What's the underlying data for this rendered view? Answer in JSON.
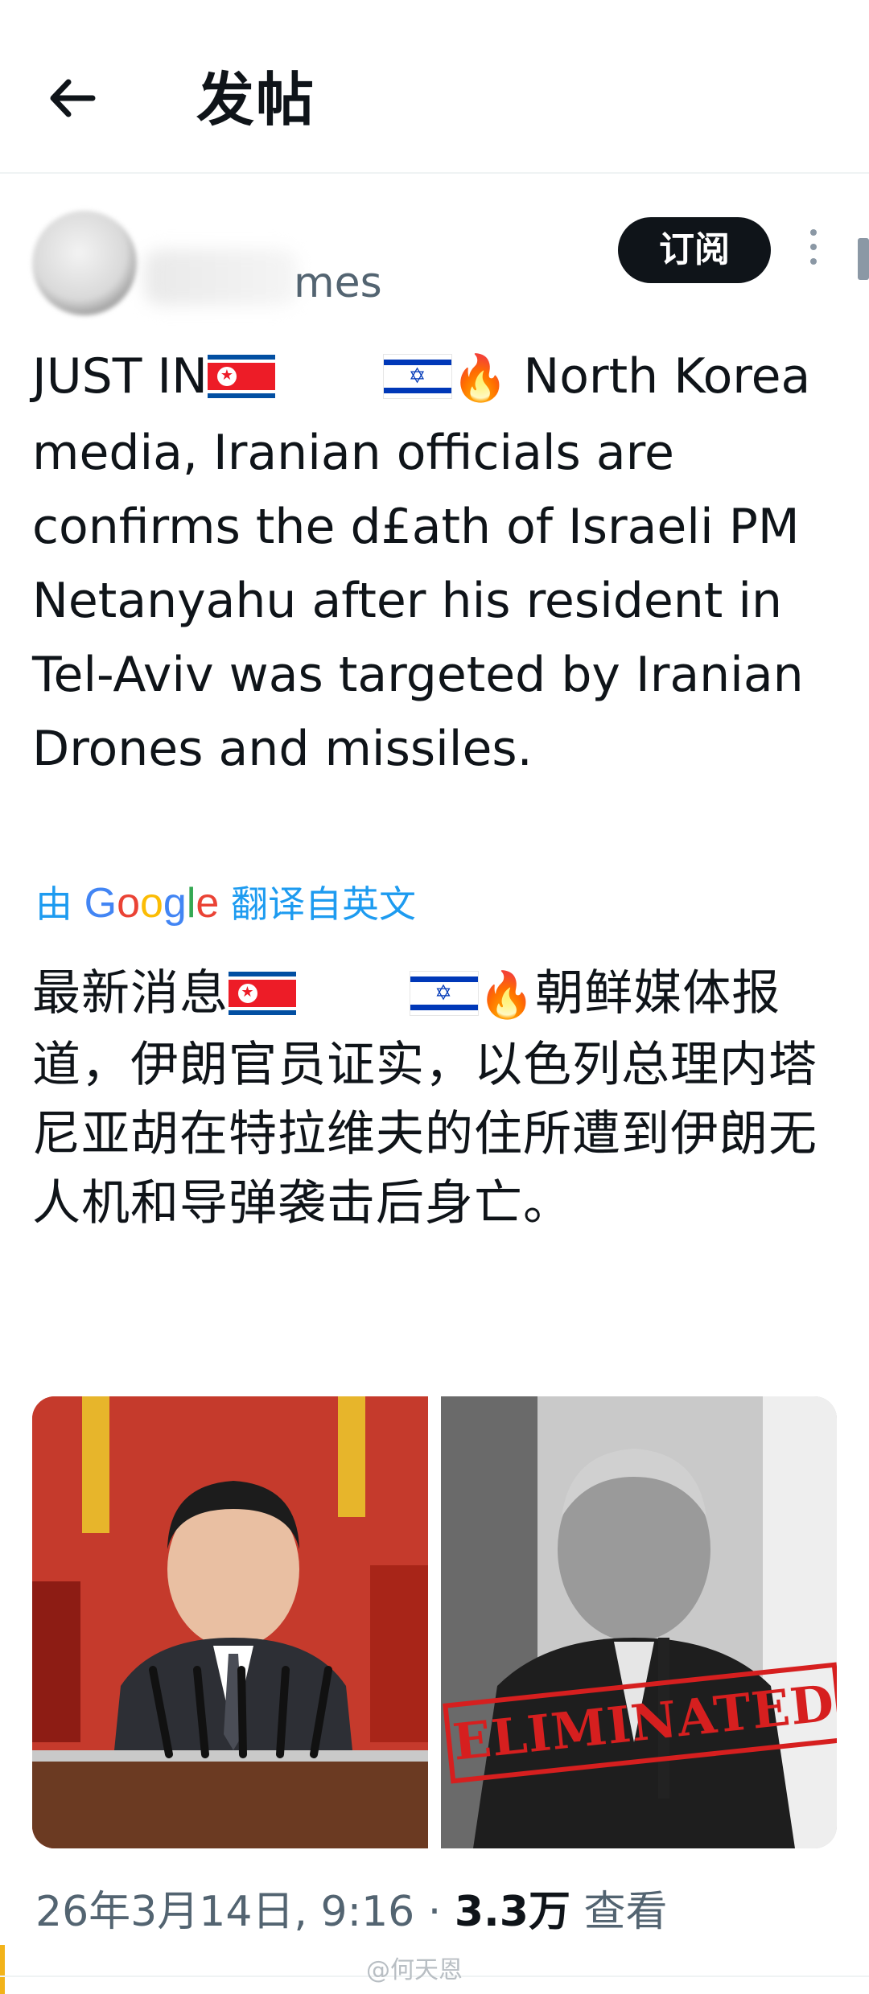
{
  "header": {
    "title": "发帖",
    "back_icon": "arrow-left-icon"
  },
  "post": {
    "author_partial": "mes",
    "subscribe_label": "订阅",
    "text_en": {
      "part1": "JUST IN",
      "part2": " North Korea media, Iranian officials are confirms the d£ath of Israeli PM Netanyahu after his resident in Tel-Aviv was targeted by Iranian Drones and missiles."
    },
    "translation": {
      "prefix": "由",
      "logo": "Google",
      "suffix": "翻译自英文"
    },
    "text_zh": {
      "part1": "最新消息",
      "part2": "朝鲜媒体报道，伊朗官员证实，以色列总理内塔尼亚胡在特拉维夫的住所遭到伊朗无人机和导弹袭击后身亡。"
    },
    "media": {
      "stamp_text": "ELIMINATED"
    },
    "meta": {
      "timestamp": "26年3月14日, 9:16 · ",
      "views": "3.3万",
      "views_label": " 查看"
    }
  },
  "watermark": "@何天恩",
  "colors": {
    "link": "#1d9bf0",
    "text": "#0f1419",
    "muted": "#536471",
    "button": "#0f1419",
    "stamp": "#d61f1f"
  }
}
